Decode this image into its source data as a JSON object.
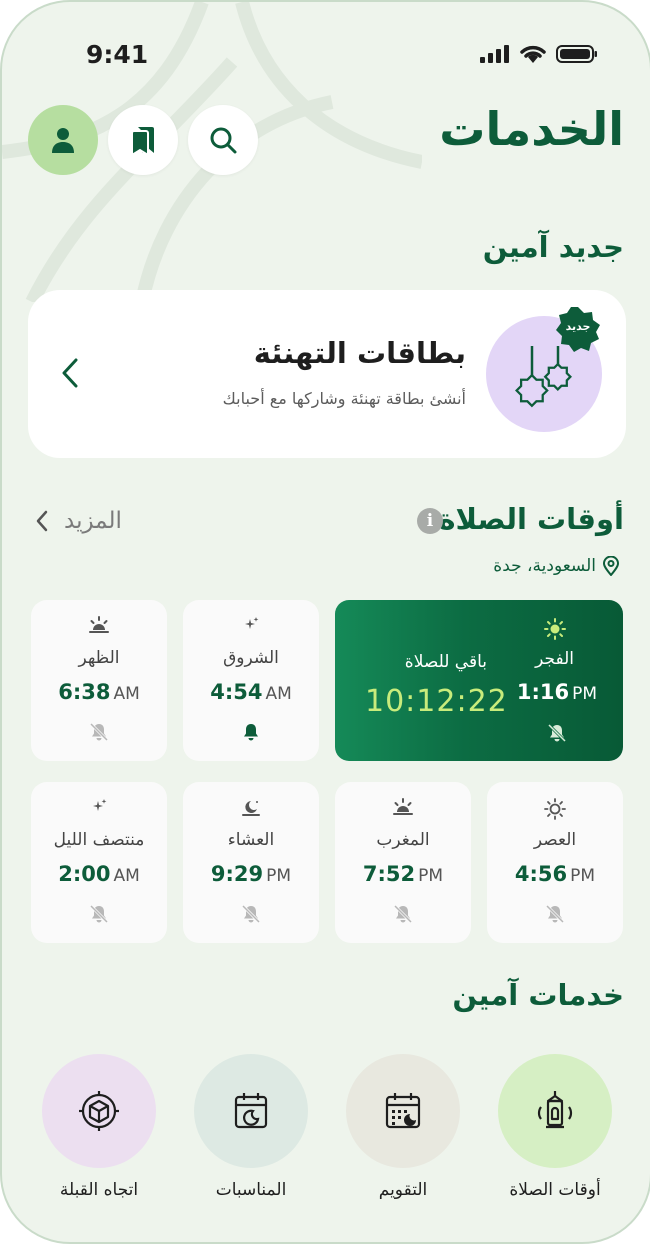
{
  "status": {
    "time": "9:41"
  },
  "header": {
    "title": "الخدمات"
  },
  "new_section": {
    "title": "جديد آمين"
  },
  "promo": {
    "badge": "جديد",
    "title": "بطاقات التهنئة",
    "subtitle": "أنشئ بطاقة تهنئة وشاركها مع أحبابك"
  },
  "prayer": {
    "title": "أوقات الصلاة",
    "more": "المزيد",
    "location": "السعودية، جدة",
    "remaining_label": "باقي للصلاة",
    "countdown": "10:12:22",
    "times": [
      {
        "name": "الفجر",
        "time": "1:16",
        "ampm": "PM",
        "icon": "sun-icon",
        "bell": "bell-off-icon"
      },
      {
        "name": "الشروق",
        "time": "4:54",
        "ampm": "AM",
        "icon": "sparkle-icon",
        "bell": "bell-icon"
      },
      {
        "name": "الظهر",
        "time": "6:38",
        "ampm": "AM",
        "icon": "sunrise-icon",
        "bell": "bell-off-icon"
      },
      {
        "name": "العصر",
        "time": "4:56",
        "ampm": "PM",
        "icon": "sun-outline-icon",
        "bell": "bell-off-icon"
      },
      {
        "name": "المغرب",
        "time": "7:52",
        "ampm": "PM",
        "icon": "sunset-icon",
        "bell": "bell-off-icon"
      },
      {
        "name": "العشاء",
        "time": "9:29",
        "ampm": "PM",
        "icon": "moon-icon",
        "bell": "bell-off-icon"
      },
      {
        "name": "منتصف الليل",
        "time": "2:00",
        "ampm": "AM",
        "icon": "sparkle-icon",
        "bell": "bell-off-icon"
      }
    ]
  },
  "services": {
    "title": "خدمات آمين",
    "items": [
      {
        "label": "أوقات الصلاة",
        "icon": "lantern-icon",
        "color": "#d6efc4"
      },
      {
        "label": "التقويم",
        "icon": "calendar-icon",
        "color": "#e8e8df"
      },
      {
        "label": "المناسبات",
        "icon": "event-calendar-icon",
        "color": "#dde9e3"
      },
      {
        "label": "اتجاه القبلة",
        "icon": "qibla-compass-icon",
        "color": "#ecdff0"
      }
    ]
  },
  "colors": {
    "primary": "#0d5c3a",
    "background": "#eef4ec",
    "accent": "#c8ec7c"
  }
}
